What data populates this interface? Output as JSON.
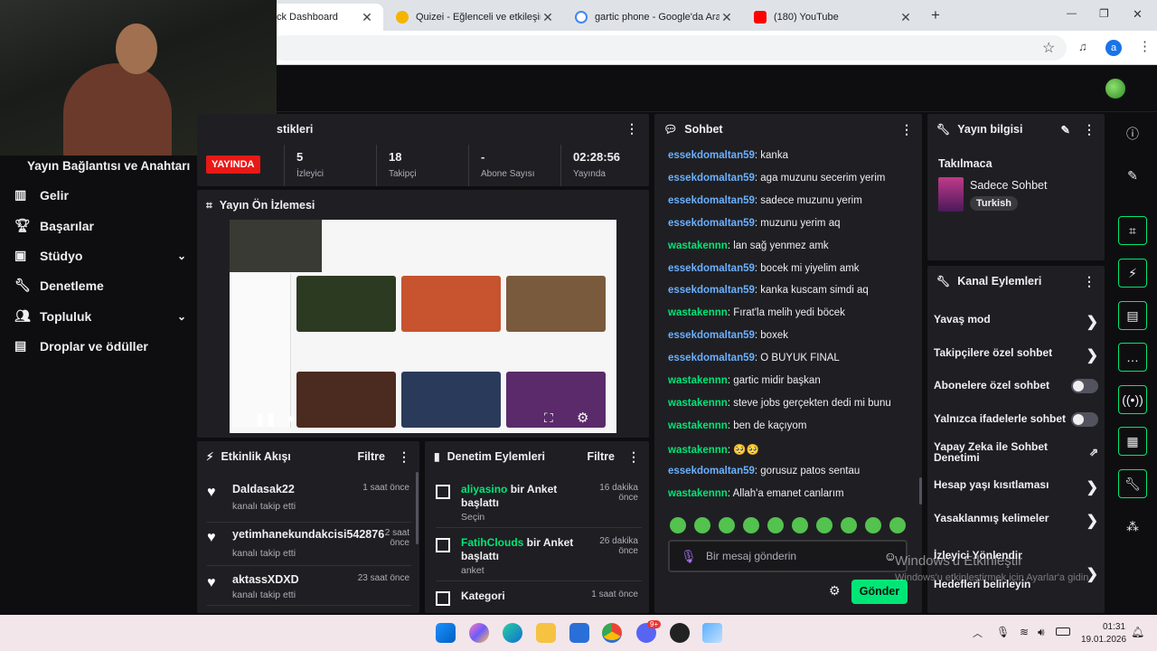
{
  "browser": {
    "tabs": [
      {
        "label": "ck Dashboard"
      },
      {
        "label": "Quizei - Eğlenceli ve etkileşimli"
      },
      {
        "label": "gartic phone - Google'da Ara"
      },
      {
        "label": "(180) YouTube"
      }
    ],
    "new_tab": "+",
    "profile_initial": "a",
    "window_controls": {
      "min": "—",
      "max": "❐",
      "close": "✕"
    }
  },
  "sidebar": {
    "stream_key": "Yayın Bağlantısı ve Anahtarı",
    "items": [
      {
        "label": "Gelir",
        "icon": "chart-icon"
      },
      {
        "label": "Başarılar",
        "icon": "trophy-icon"
      },
      {
        "label": "Stüdyo",
        "icon": "studio-icon",
        "chevron": "⌄"
      },
      {
        "label": "Denetleme",
        "icon": "wrench-icon"
      },
      {
        "label": "Topluluk",
        "icon": "people-icon",
        "chevron": "⌄"
      },
      {
        "label": "Droplar ve ödüller",
        "icon": "gift-icon"
      }
    ]
  },
  "stats": {
    "title": "stikleri",
    "live_badge": "YAYINDA",
    "values": [
      {
        "value": "5",
        "label": "İzleyici"
      },
      {
        "value": "18",
        "label": "Takipçi"
      },
      {
        "value": "-",
        "label": "Abone Sayısı"
      },
      {
        "value": "02:28:56",
        "label": "Yayında"
      }
    ]
  },
  "preview": {
    "title": "Yayın Ön İzlemesi"
  },
  "activity": {
    "title": "Etkinlik Akışı",
    "filter": "Filtre",
    "items": [
      {
        "name": "Daldasak22",
        "action": "kanalı takip etti",
        "time": "1 saat önce"
      },
      {
        "name": "yetimhanekundakcisi542876",
        "action": "kanalı takip etti",
        "time": "2 saat önce"
      },
      {
        "name": "aktassXDXD",
        "action": "kanalı takip etti",
        "time": "23 saat önce"
      }
    ]
  },
  "moderation": {
    "title": "Denetim Eylemleri",
    "filter": "Filtre",
    "items": [
      {
        "user": "aliyasino",
        "action": "bir Anket başlattı",
        "detail": "Seçin",
        "time": "16 dakika önce"
      },
      {
        "user": "FatihClouds",
        "action": "bir Anket başlattı",
        "detail": "anket",
        "time": "26 dakika önce"
      },
      {
        "user": "",
        "action": "Kategori",
        "detail": "",
        "time": "1 saat önce"
      }
    ]
  },
  "chat": {
    "title": "Sohbet",
    "messages": [
      {
        "user": "essekdomaltan59",
        "color": "#6ab0ff",
        "text": "kanka"
      },
      {
        "user": "essekdomaltan59",
        "color": "#6ab0ff",
        "text": "aga muzunu secerim yerim"
      },
      {
        "user": "essekdomaltan59",
        "color": "#6ab0ff",
        "text": "sadece muzunu yerim"
      },
      {
        "user": "essekdomaltan59",
        "color": "#6ab0ff",
        "text": "muzunu yerim aq"
      },
      {
        "user": "wastakennn",
        "color": "#00e676",
        "text": "lan sağ yenmez amk"
      },
      {
        "user": "essekdomaltan59",
        "color": "#6ab0ff",
        "text": "bocek mi yiyelim amk"
      },
      {
        "user": "essekdomaltan59",
        "color": "#6ab0ff",
        "text": "kanka kuscam simdi aq"
      },
      {
        "user": "wastakennn",
        "color": "#00e676",
        "text": "Fırat'la melih yedi böcek"
      },
      {
        "user": "essekdomaltan59",
        "color": "#6ab0ff",
        "text": "boxek"
      },
      {
        "user": "essekdomaltan59",
        "color": "#6ab0ff",
        "text": "O BUYUK FINAL"
      },
      {
        "user": "wastakennn",
        "color": "#00e676",
        "text": "gartic midir başkan"
      },
      {
        "user": "wastakennn",
        "color": "#00e676",
        "text": "steve jobs gerçekten dedi mi bunu"
      },
      {
        "user": "wastakennn",
        "color": "#00e676",
        "text": "ben de kaçıyom"
      },
      {
        "user": "wastakennn",
        "color": "#00e676",
        "text": "🥺🥺"
      },
      {
        "user": "essekdomaltan59",
        "color": "#6ab0ff",
        "text": "gorusuz patos sentau"
      },
      {
        "user": "wastakennn",
        "color": "#00e676",
        "text": "Allah'a emanet canlarım"
      }
    ],
    "placeholder": "Bir mesaj gönderin",
    "send": "Gönder"
  },
  "stream_info": {
    "title": "Yayın bilgisi",
    "nickname": "Takılmaca",
    "category": "Sadece Sohbet",
    "tag": "Turkish"
  },
  "channel_actions": {
    "title": "Kanal Eylemleri",
    "items": [
      {
        "label": "Yavaş mod",
        "kind": "chevron"
      },
      {
        "label": "Takipçilere özel sohbet",
        "kind": "chevron"
      },
      {
        "label": "Abonelere özel sohbet",
        "kind": "toggle"
      },
      {
        "label": "Yalnızca ifadelerle sohbet",
        "kind": "toggle"
      },
      {
        "label": "Yapay Zeka ile Sohbet Denetimi",
        "kind": "external"
      },
      {
        "label": "Hesap yaşı kısıtlaması",
        "kind": "chevron"
      },
      {
        "label": "Yasaklanmış kelimeler",
        "kind": "chevron"
      },
      {
        "label": "İzleyici Yönlendir Hedefleri belirleyin",
        "kind": "chevron"
      }
    ]
  },
  "watermark": {
    "line1": "Windows'u Etkinleştir",
    "line2": "Windows'u etkinleştirmek için Ayarlar'a gidin."
  },
  "taskbar": {
    "time": "01:31",
    "date": "19.01.2026",
    "discord_badge": "9+"
  }
}
